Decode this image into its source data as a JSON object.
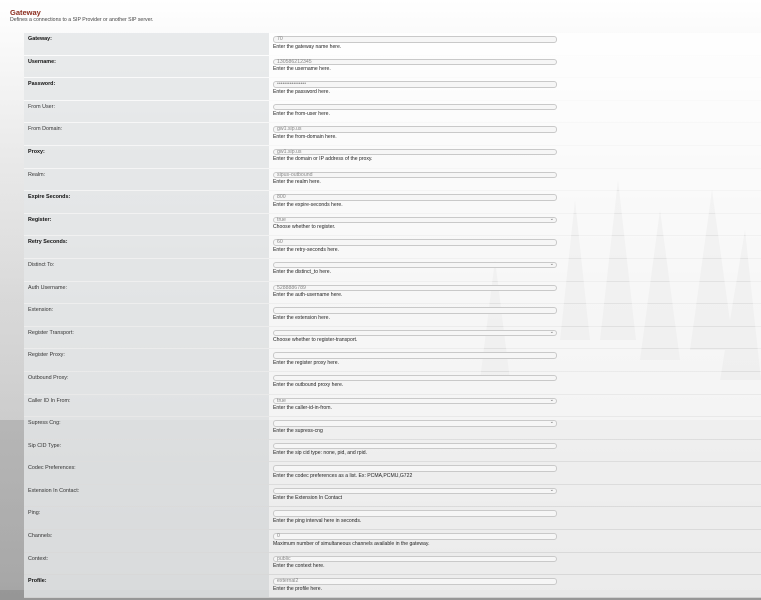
{
  "header": {
    "title": "Gateway",
    "subtitle": "Defines a connections to a SIP Provider or another SIP server."
  },
  "rows": [
    {
      "label": "Gateway:",
      "bold": true,
      "value": "70",
      "select": false,
      "help": "Enter the gateway name here."
    },
    {
      "label": "Username:",
      "bold": true,
      "value": "130586212345",
      "select": false,
      "help": "Enter the username here."
    },
    {
      "label": "Password:",
      "bold": true,
      "value": "••••••••••••••••",
      "select": false,
      "help": "Enter the password here."
    },
    {
      "label": "From User:",
      "bold": false,
      "value": "",
      "select": false,
      "help": "Enter the from-user here."
    },
    {
      "label": "From Domain:",
      "bold": false,
      "value": "gw1.sip.us",
      "select": false,
      "help": "Enter the from-domain here."
    },
    {
      "label": "Proxy:",
      "bold": true,
      "value": "gw1.sip.us",
      "select": false,
      "help": "Enter the domain or IP address of the proxy."
    },
    {
      "label": "Realm:",
      "bold": false,
      "value": "sipus-outbound",
      "select": false,
      "help": "Enter the realm here."
    },
    {
      "label": "Expire Seconds:",
      "bold": true,
      "value": "800",
      "select": false,
      "help": "Enter the expire-seconds here."
    },
    {
      "label": "Register:",
      "bold": true,
      "value": "true",
      "select": true,
      "help": "Choose whether to register."
    },
    {
      "label": "Retry Seconds:",
      "bold": true,
      "value": "60",
      "select": false,
      "help": "Enter the retry-seconds here."
    },
    {
      "label": "Distinct To:",
      "bold": false,
      "value": "",
      "select": true,
      "help": "Enter the distinct_to here."
    },
    {
      "label": "Auth Username:",
      "bold": false,
      "value": "5288886789",
      "select": false,
      "help": "Enter the auth-username here."
    },
    {
      "label": "Extension:",
      "bold": false,
      "value": "",
      "select": false,
      "help": "Enter the extension here."
    },
    {
      "label": "Register Transport:",
      "bold": false,
      "value": "",
      "select": true,
      "help": "Choose whether to register-transport."
    },
    {
      "label": "Register Proxy:",
      "bold": false,
      "value": "",
      "select": false,
      "help": "Enter the register proxy here."
    },
    {
      "label": "Outbound Proxy:",
      "bold": false,
      "value": "",
      "select": false,
      "help": "Enter the outbound proxy here."
    },
    {
      "label": "Caller ID In From:",
      "bold": false,
      "value": "true",
      "select": true,
      "help": "Enter the caller-id-in-from."
    },
    {
      "label": "Supress Cng:",
      "bold": false,
      "value": "",
      "select": true,
      "help": "Enter the supress-cng"
    },
    {
      "label": "Sip CID Type:",
      "bold": false,
      "value": "",
      "select": false,
      "help": "Enter the sip cid type: none, pid, and rpid."
    },
    {
      "label": "Codec Preferences:",
      "bold": false,
      "value": "",
      "select": false,
      "help": "Enter the codec preferences as a list. Ex: PCMA,PCMU,G722"
    },
    {
      "label": "Extension In Contact:",
      "bold": false,
      "value": "",
      "select": true,
      "help": "Enter the Extension In Contact"
    },
    {
      "label": "Ping:",
      "bold": false,
      "value": "",
      "select": false,
      "help": "Enter the ping interval here in seconds."
    },
    {
      "label": "Channels:",
      "bold": false,
      "value": "0",
      "select": false,
      "help": "Maximum number of simultaneous channels available in the gateway."
    },
    {
      "label": "Context:",
      "bold": false,
      "value": "public",
      "select": false,
      "help": "Enter the context here."
    },
    {
      "label": "Profile:",
      "bold": true,
      "value": "external2",
      "select": false,
      "help": "Enter the profile here."
    }
  ]
}
